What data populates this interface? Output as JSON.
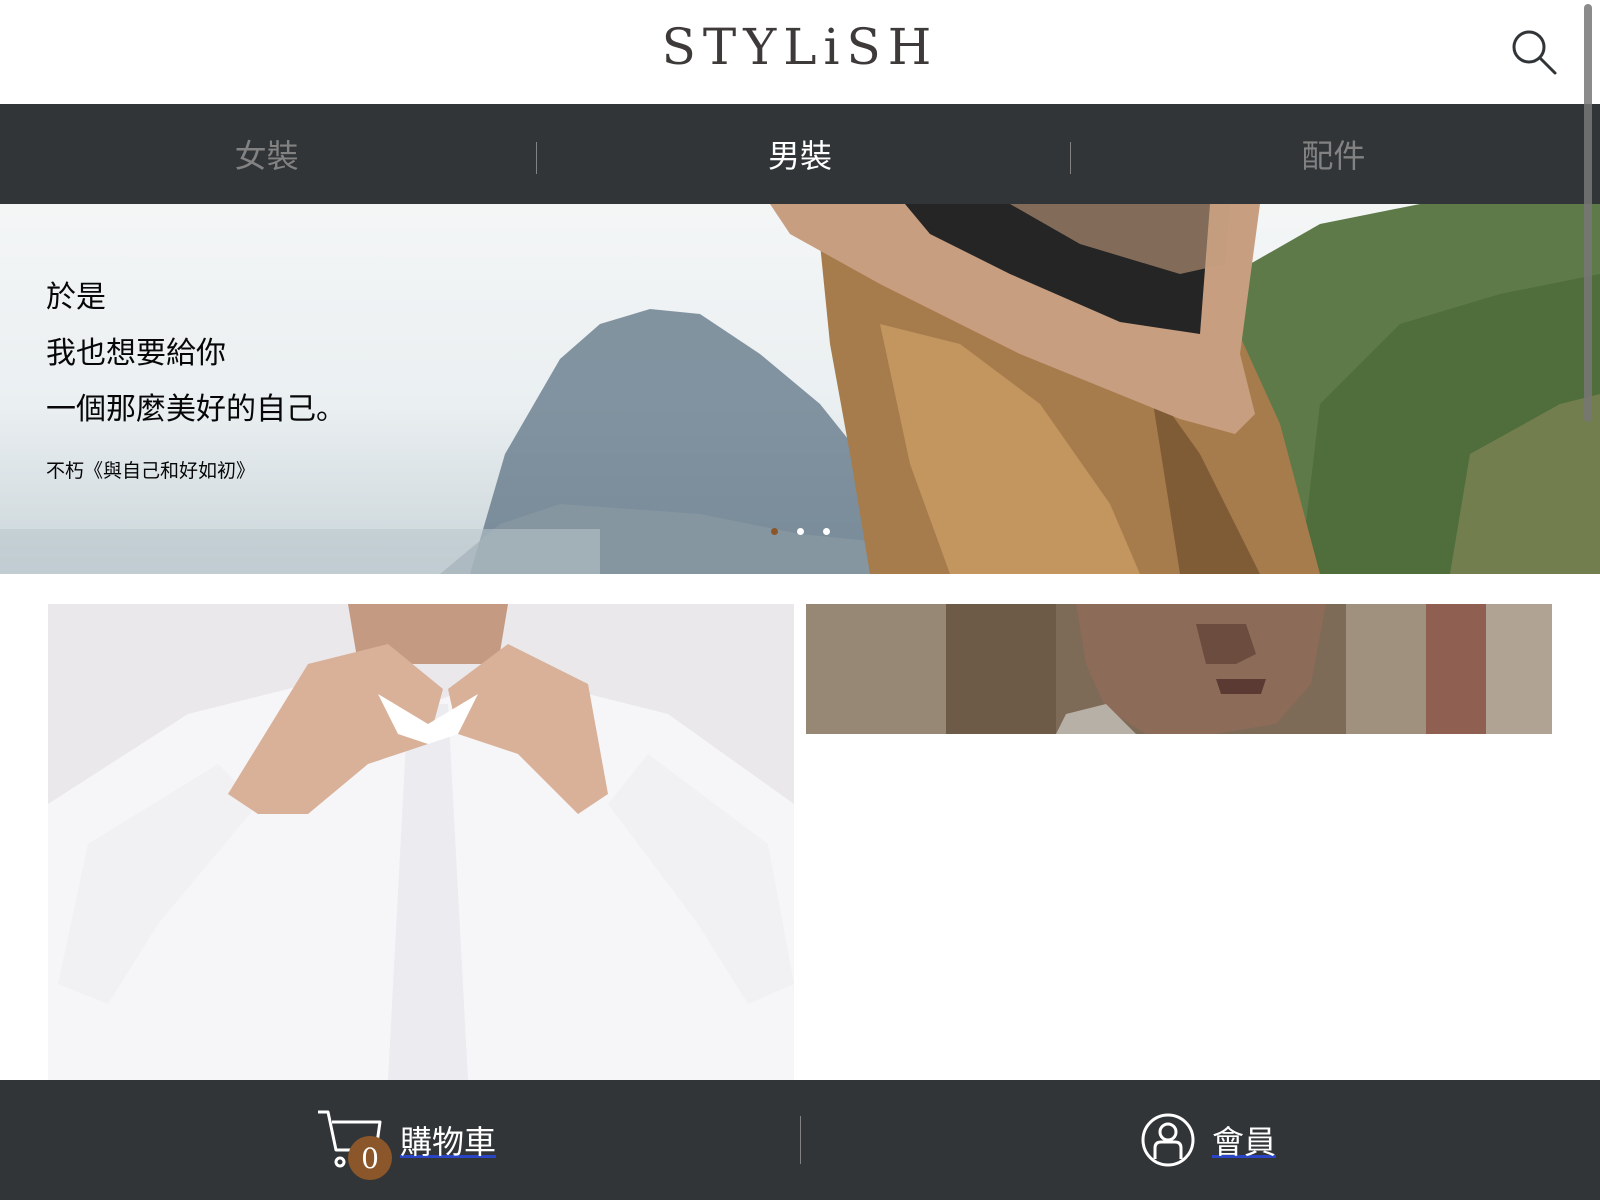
{
  "header": {
    "logo_text": "STYLiSH",
    "search_icon": "search-icon"
  },
  "categories": [
    {
      "label": "女裝",
      "active": false
    },
    {
      "label": "男裝",
      "active": true
    },
    {
      "label": "配件",
      "active": false
    }
  ],
  "hero": {
    "lines": [
      "於是",
      "我也想要給你",
      "一個那麼美好的自己。"
    ],
    "source": "不朽《與自己和好如初》",
    "slides": 3,
    "active_slide": 1
  },
  "bottom_bar": {
    "cart_label": "購物車",
    "cart_count": "0",
    "cart_icon": "cart-icon",
    "member_label": "會員",
    "member_icon": "member-icon"
  },
  "colors": {
    "nav_bg": "#313538",
    "accent": "#8b572a",
    "nav_inactive": "#828282",
    "link_underline": "#2b45c7"
  }
}
